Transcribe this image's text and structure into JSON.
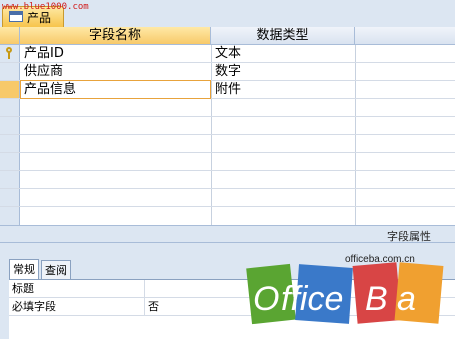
{
  "watermark": "www.blue1000.com",
  "doc_tab": {
    "label": "产品",
    "icon": "table-icon"
  },
  "grid": {
    "columns": [
      "字段名称",
      "数据类型"
    ],
    "rows": [
      {
        "name": "产品ID",
        "type": "文本",
        "primary_key": true
      },
      {
        "name": "供应商",
        "type": "数字",
        "primary_key": false
      },
      {
        "name": "产品信息",
        "type": "附件",
        "primary_key": false,
        "active": true
      }
    ]
  },
  "properties_header": "字段属性",
  "subtabs": [
    "常规",
    "查阅"
  ],
  "properties": [
    {
      "label": "标题",
      "value": ""
    },
    {
      "label": "必填字段",
      "value": "否"
    }
  ],
  "logo": {
    "small_text": "officeba.com.cn",
    "letters": [
      "O",
      "ffice",
      "B",
      "a"
    ]
  },
  "colors": {
    "accent": "#f7c96a",
    "chrome": "#dce6f2",
    "watermark": "#d01a1a"
  }
}
